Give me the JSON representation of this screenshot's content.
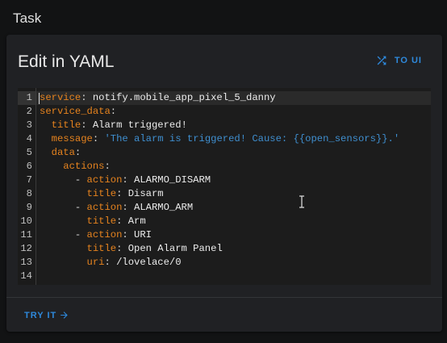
{
  "header": {
    "title": "Task"
  },
  "card": {
    "title": "Edit in YAML",
    "to_ui_label": "TO UI",
    "try_it_label": "TRY IT"
  },
  "editor": {
    "line_numbers": [
      "1",
      "2",
      "3",
      "4",
      "5",
      "6",
      "7",
      "8",
      "9",
      "10",
      "11",
      "12",
      "13",
      "14"
    ],
    "lines": [
      {
        "indent": "",
        "dash": "",
        "key": "service",
        "value": "notify.mobile_app_pixel_5_danny",
        "value_type": "plain"
      },
      {
        "indent": "",
        "dash": "",
        "key": "service_data",
        "value": "",
        "value_type": "plain"
      },
      {
        "indent": "  ",
        "dash": "",
        "key": "title",
        "value": "Alarm triggered!",
        "value_type": "plain"
      },
      {
        "indent": "  ",
        "dash": "",
        "key": "message",
        "value": "'The alarm is triggered! Cause: {{open_sensors}}.'",
        "value_type": "string"
      },
      {
        "indent": "  ",
        "dash": "",
        "key": "data",
        "value": "",
        "value_type": "plain"
      },
      {
        "indent": "    ",
        "dash": "",
        "key": "actions",
        "value": "",
        "value_type": "plain"
      },
      {
        "indent": "      ",
        "dash": "- ",
        "key": "action",
        "value": "ALARMO_DISARM",
        "value_type": "plain"
      },
      {
        "indent": "        ",
        "dash": "",
        "key": "title",
        "value": "Disarm",
        "value_type": "plain"
      },
      {
        "indent": "      ",
        "dash": "- ",
        "key": "action",
        "value": "ALARMO_ARM",
        "value_type": "plain"
      },
      {
        "indent": "        ",
        "dash": "",
        "key": "title",
        "value": "Arm",
        "value_type": "plain"
      },
      {
        "indent": "      ",
        "dash": "- ",
        "key": "action",
        "value": "URI",
        "value_type": "plain"
      },
      {
        "indent": "        ",
        "dash": "",
        "key": "title",
        "value": "Open Alarm Panel",
        "value_type": "plain"
      },
      {
        "indent": "        ",
        "dash": "",
        "key": "uri",
        "value": "/lovelace/0",
        "value_type": "plain"
      },
      {
        "indent": "",
        "dash": "",
        "key": "",
        "value": "",
        "value_type": "plain"
      }
    ]
  },
  "colors": {
    "accent": "#2e89dc",
    "yaml_key": "#e6831e",
    "yaml_string": "#3f8fd0",
    "background": "#121314",
    "card": "#202124"
  },
  "icons": {
    "to_ui": "shuffle-icon",
    "try_it": "arrow-right-icon"
  }
}
